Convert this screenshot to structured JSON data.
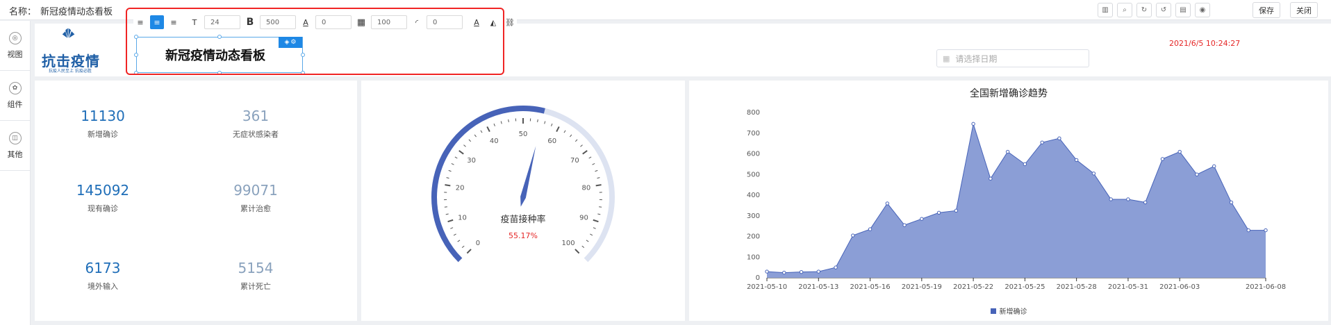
{
  "topbar": {
    "name_label": "名称：",
    "name_value": "新冠疫情动态看板",
    "icons": [
      "grid-icon",
      "search-icon",
      "refresh-icon",
      "undo-icon",
      "document-icon",
      "eye-icon"
    ],
    "save_label": "保存",
    "close_label": "关闭"
  },
  "rail": [
    {
      "label": "视图",
      "icon": "view-icon"
    },
    {
      "label": "组件",
      "icon": "gear-icon"
    },
    {
      "label": "其他",
      "icon": "other-icon"
    }
  ],
  "format_toolbar": {
    "font_size": "24",
    "font_weight": "500",
    "letter_spacing": "0",
    "opacity": "100",
    "radius": "0",
    "align_active": "center"
  },
  "header": {
    "logo_text": "抗击疫情",
    "logo_sub": "抗疫人民至上  抗疫必胜",
    "title": "新冠疫情动态看板",
    "date_placeholder": "请选择日期",
    "datetime": "2021/6/5 10:24:27"
  },
  "stats": [
    {
      "value": "11130",
      "label": "新增确诊",
      "tone": "blue"
    },
    {
      "value": "361",
      "label": "无症状感染者",
      "tone": "grey"
    },
    {
      "value": "145092",
      "label": "现有确诊",
      "tone": "blue"
    },
    {
      "value": "99071",
      "label": "累计治愈",
      "tone": "grey"
    },
    {
      "value": "6173",
      "label": "境外输入",
      "tone": "blue"
    },
    {
      "value": "5154",
      "label": "累计死亡",
      "tone": "grey"
    }
  ],
  "gauge": {
    "title": "疫苗接种率",
    "value_text": "55.17%",
    "value": 55.17,
    "min": 0,
    "max": 100,
    "tick_labels": [
      "0",
      "10",
      "20",
      "30",
      "40",
      "50",
      "60",
      "70",
      "80",
      "90",
      "100"
    ],
    "colors": {
      "fill": "#4763b8",
      "track": "#dde3f1",
      "value_text": "#e52626"
    }
  },
  "chart_data": {
    "type": "area",
    "title": "全国新增确诊趋势",
    "x": [
      "2021-05-10",
      "2021-05-11",
      "2021-05-12",
      "2021-05-13",
      "2021-05-14",
      "2021-05-15",
      "2021-05-16",
      "2021-05-17",
      "2021-05-18",
      "2021-05-19",
      "2021-05-20",
      "2021-05-21",
      "2021-05-22",
      "2021-05-23",
      "2021-05-24",
      "2021-05-25",
      "2021-05-26",
      "2021-05-27",
      "2021-05-28",
      "2021-05-29",
      "2021-05-30",
      "2021-05-31",
      "2021-06-01",
      "2021-06-02",
      "2021-06-03",
      "2021-06-04",
      "2021-06-05",
      "2021-06-06",
      "2021-06-07",
      "2021-06-08"
    ],
    "x_tick_labels": [
      "2021-05-10",
      "2021-05-13",
      "2021-05-16",
      "2021-05-19",
      "2021-05-22",
      "2021-05-25",
      "2021-05-28",
      "2021-05-31",
      "2021-06-03",
      "2021-06-08"
    ],
    "series": [
      {
        "name": "新增确诊",
        "values": [
          30,
          25,
          28,
          30,
          50,
          205,
          235,
          360,
          255,
          285,
          315,
          325,
          745,
          480,
          610,
          550,
          655,
          675,
          570,
          505,
          380,
          380,
          365,
          575,
          610,
          500,
          540,
          365,
          230,
          230
        ]
      }
    ],
    "ylim": [
      0,
      800
    ],
    "yticks": [
      0,
      100,
      200,
      300,
      400,
      500,
      600,
      700,
      800
    ],
    "grid": false,
    "legend_placement": "bottom-center",
    "colors": {
      "area": "#8b9ed6",
      "line": "#4763b8"
    }
  }
}
